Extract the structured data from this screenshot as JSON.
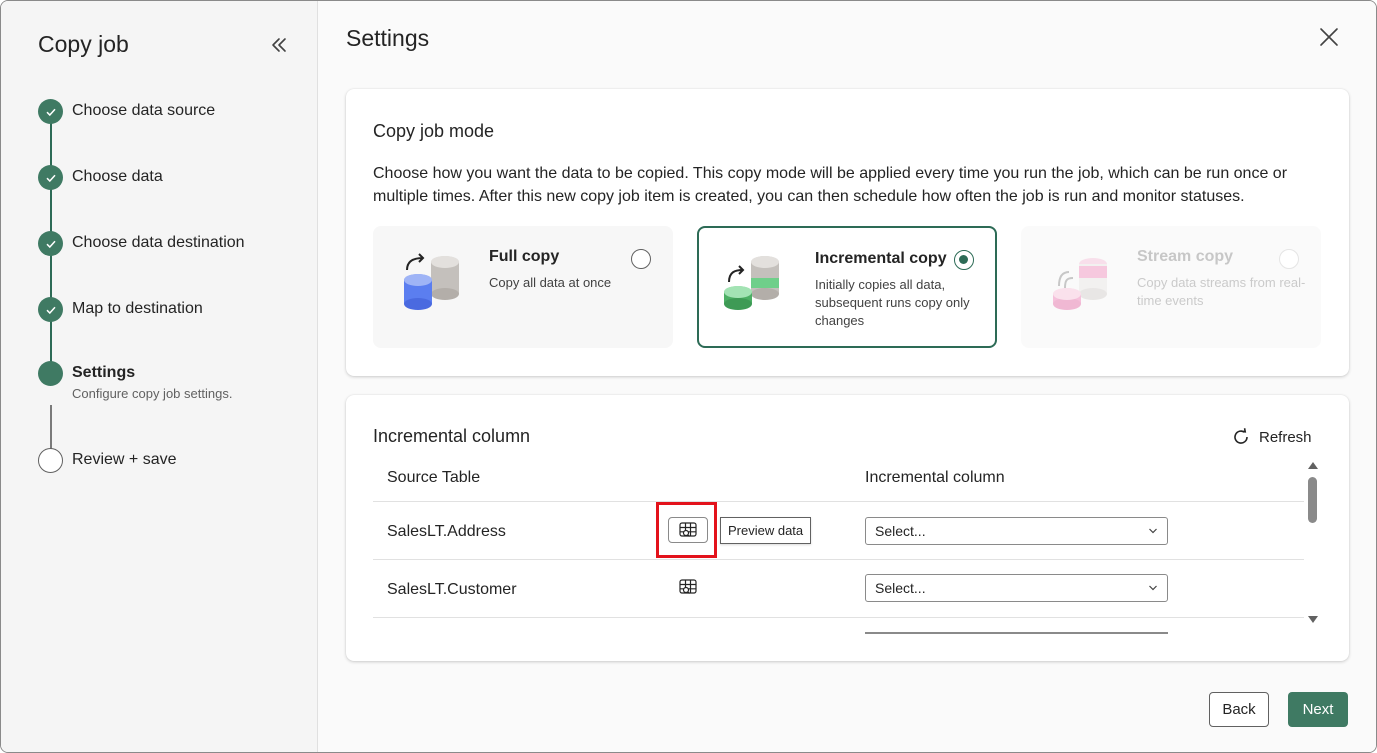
{
  "sidebar": {
    "title": "Copy job",
    "steps": [
      {
        "label": "Choose data source",
        "state": "done"
      },
      {
        "label": "Choose data",
        "state": "done"
      },
      {
        "label": "Choose data destination",
        "state": "done"
      },
      {
        "label": "Map to destination",
        "state": "done"
      },
      {
        "label": "Settings",
        "state": "current",
        "sub": "Configure copy job settings."
      },
      {
        "label": "Review + save",
        "state": "pending"
      }
    ]
  },
  "main": {
    "title": "Settings",
    "mode_card": {
      "heading": "Copy job mode",
      "description": "Choose how you want the data to be copied. This copy mode will be applied every time you run the job, which can be run once or multiple times. After this new copy job item is created, you can then schedule how often the job is run and monitor statuses.",
      "modes": [
        {
          "title": "Full copy",
          "desc": "Copy all data at once",
          "selected": false,
          "disabled": false
        },
        {
          "title": "Incremental copy",
          "desc": "Initially copies all data, subsequent runs copy only changes",
          "selected": true,
          "disabled": false
        },
        {
          "title": "Stream copy",
          "desc": "Copy data streams from real-time events",
          "selected": false,
          "disabled": true
        }
      ]
    },
    "column_card": {
      "heading": "Incremental column",
      "refresh_label": "Refresh",
      "headers": {
        "source": "Source Table",
        "column": "Incremental column"
      },
      "rows": [
        {
          "table": "SalesLT.Address",
          "column": "Select..."
        },
        {
          "table": "SalesLT.Customer",
          "column": "Select..."
        }
      ],
      "tooltip": "Preview data"
    }
  },
  "footer": {
    "back": "Back",
    "next": "Next"
  },
  "colors": {
    "accent": "#3f7a63",
    "highlight": "#e3121b"
  }
}
